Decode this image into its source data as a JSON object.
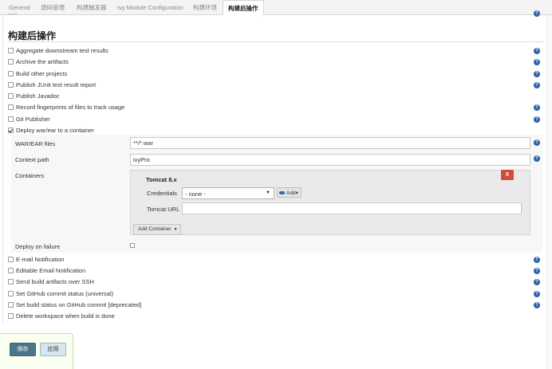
{
  "tabs": [
    {
      "label": "General",
      "active": false
    },
    {
      "label": "源码管理",
      "active": false
    },
    {
      "label": "构建触发器",
      "active": false
    },
    {
      "label": "Ivy Module Configuration",
      "active": false
    },
    {
      "label": "构建环境",
      "active": false
    },
    {
      "label": "构建后操作",
      "active": true
    }
  ],
  "cut_row_label": "......",
  "section_title": "构建后操作",
  "actions_top": [
    {
      "label": "Aggregate downstream test results",
      "checked": false,
      "help": true
    },
    {
      "label": "Archive the artifacts",
      "checked": false,
      "help": true
    },
    {
      "label": "Build other projects",
      "checked": false,
      "help": true
    },
    {
      "label": "Publish JUnit test result report",
      "checked": false,
      "help": true
    },
    {
      "label": "Publish Javadoc",
      "checked": false,
      "help": false
    },
    {
      "label": "Record fingerprints of files to track usage",
      "checked": false,
      "help": true
    },
    {
      "label": "Git Publisher",
      "checked": false,
      "help": true
    },
    {
      "label": "Deploy war/ear to a container",
      "checked": true,
      "help": false
    }
  ],
  "deploy": {
    "war_label": "WAR/EAR files",
    "war_value": "**/*.war",
    "context_label": "Context path",
    "context_value": "ivyPro",
    "containers_label": "Containers",
    "container_title": "Tomcat 8.x",
    "close_label": "X",
    "credentials_label": "Credentials",
    "credentials_value": "- none -",
    "add_label": "Add",
    "tomcat_url_label": "Tomcat URL",
    "tomcat_url_value": "",
    "add_container_label": "Add Container",
    "deploy_on_failure_label": "Deploy on failure"
  },
  "actions_bottom": [
    {
      "label": "E-mail Notification",
      "checked": false,
      "help": true
    },
    {
      "label": "Editable Email Notification",
      "checked": false,
      "help": true
    },
    {
      "label": "Send build artifacts over SSH",
      "checked": false,
      "help": true
    },
    {
      "label": "Set GitHub commit status (universal)",
      "checked": false,
      "help": true
    },
    {
      "label": "Set build status on GitHub commit [deprecated]",
      "checked": false,
      "help": true
    },
    {
      "label": "Delete workspace when build is done",
      "checked": false,
      "help": false
    }
  ],
  "help_glyph": "?",
  "footer": {
    "save_label": "保存",
    "apply_label": "应用"
  },
  "colors": {
    "save": "#4b758b",
    "apply": "#d7e5ef",
    "help": "#2e62a8",
    "close": "#d24a3c"
  }
}
